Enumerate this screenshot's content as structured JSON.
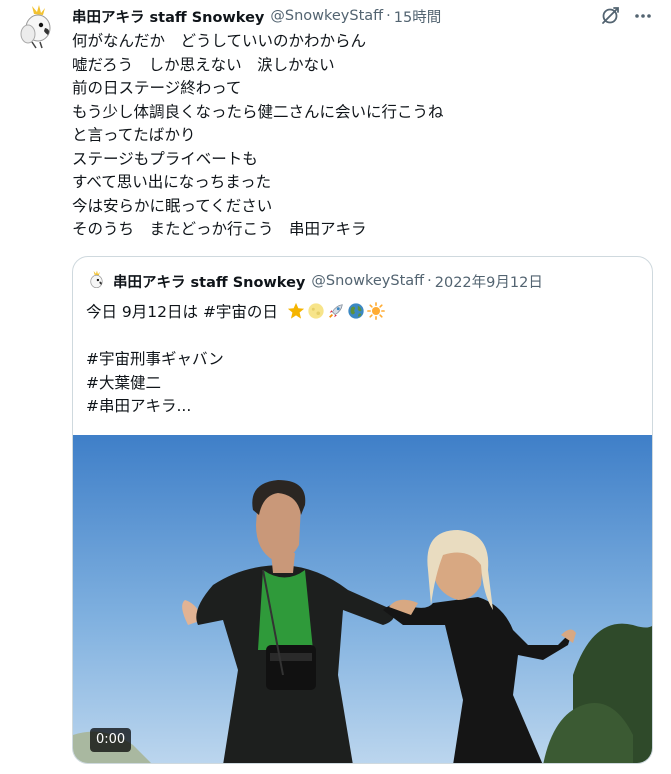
{
  "tweet": {
    "display_name": "串田アキラ staff Snowkey",
    "handle": "@SnowkeyStaff",
    "separator": "·",
    "time": "15時間",
    "lines": [
      "何がなんだか　どうしていいのかわからん",
      "嘘だろう　しか思えない　涙しかない",
      "前の日ステージ終わって",
      "もう少し体調良くなったら健二さんに会いに行こうね",
      "と言ってたばかり",
      "ステージもプライベートも",
      "すべて思い出になっちまった",
      "今は安らかに眠ってください",
      "そのうち　またどっか行こう　串田アキラ"
    ]
  },
  "quote": {
    "display_name": "串田アキラ staff Snowkey",
    "handle": "@SnowkeyStaff",
    "separator": "·",
    "date": "2022年9月12日",
    "first_line": "今日 9月12日は #宇宙の日",
    "emojis": [
      "star-emoji",
      "moon-emoji",
      "rocket-emoji",
      "earth-emoji",
      "sun-emoji"
    ],
    "hashtags": [
      "#宇宙刑事ギャバン",
      "#大葉健二",
      "#串田アキラ..."
    ],
    "video_duration": "0:00"
  },
  "colors": {
    "text": "#0f1419",
    "secondary": "#536471",
    "border": "#cfd9de",
    "sky_top": "#3f7fc8",
    "sky_bottom": "#bcd6ee"
  }
}
